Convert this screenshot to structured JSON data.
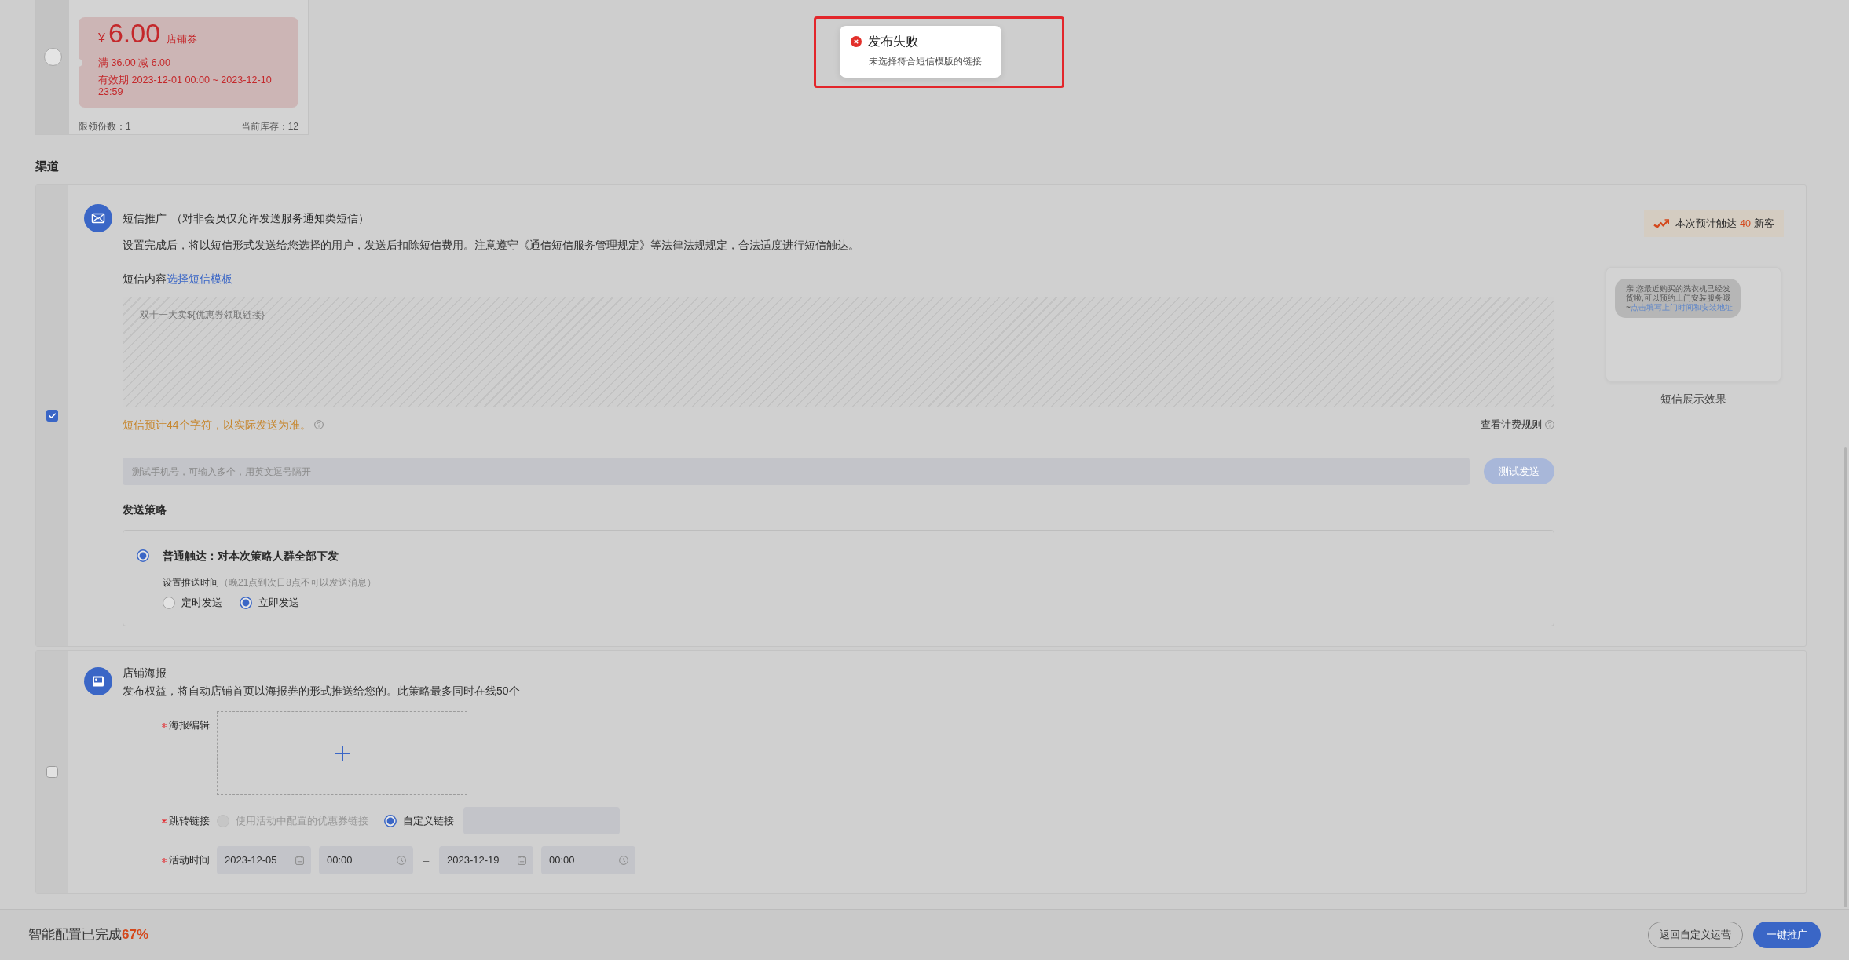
{
  "toast": {
    "kind": "error",
    "highlighted": true,
    "title": "发布失败",
    "message": "未选择符合短信模版的链接"
  },
  "coupon": {
    "selected": false,
    "currency": "¥",
    "amount": "6.00",
    "type": "店铺券",
    "rule": "满 36.00 减 6.00",
    "validity": "有效期 2023-12-01 00:00 ~ 2023-12-10 23:59",
    "limit": "限领份数：1",
    "stock": "当前库存：12"
  },
  "section_title": "渠道",
  "channels": [
    {
      "kind": "sms",
      "checked": true,
      "title": "短信推广",
      "note": "（对非会员仅允许发送服务通知类短信）",
      "description": "设置完成后，将以短信形式发送给您选择的用户，发送后扣除短信费用。注意遵守《通信短信服务管理规定》等法律法规规定，合法适度进行短信触达。",
      "content_label": "短信内容",
      "template_link": "选择短信模板",
      "content": "双十一大卖${优惠券领取链接}",
      "char_hint": "短信预计44个字符，以实际发送为准。",
      "pricing_link": "查看计费规则",
      "test_phone": {
        "placeholder": "测试手机号，可输入多个，用英文逗号隔开",
        "button": {
          "label": "测试发送",
          "disabled": true
        }
      },
      "strategy_title": "发送策略",
      "strategies": [
        {
          "label": "普通触达：对本次策略人群全部下发",
          "selected": true,
          "time_label": "设置推送时间",
          "time_note": "（晚21点到次日8点不可以发送消息）",
          "time_options": [
            {
              "label": "定时发送",
              "selected": false
            },
            {
              "label": "立即发送",
              "selected": true
            }
          ]
        }
      ],
      "reach": {
        "label": "本次预计触达",
        "count": "40",
        "unit": "新客"
      },
      "preview": {
        "message": "亲,您最近购买的洗衣机已经发货啦,可以预约上门安装服务哦~",
        "link": "点击填写上门时间和安装地址",
        "caption": "短信展示效果"
      }
    },
    {
      "kind": "poster",
      "checked": false,
      "title": "店铺海报",
      "description": "发布权益，将自动店铺首页以海报券的形式推送给您的。此策略最多同时在线50个",
      "fields": [
        {
          "kind": "upload",
          "label": "海报编辑",
          "required": true
        },
        {
          "kind": "link",
          "label": "跳转链接",
          "required": true,
          "options": [
            {
              "label": "使用活动中配置的优惠券链接",
              "selected": false,
              "disabled": true
            },
            {
              "label": "自定义链接",
              "selected": true,
              "disabled": false
            }
          ]
        },
        {
          "kind": "daterange",
          "label": "活动时间",
          "required": true,
          "start_date": "2023-12-05",
          "start_time": "00:00",
          "separator": "–",
          "end_date": "2023-12-19",
          "end_time": "00:00"
        }
      ]
    }
  ],
  "footer": {
    "progress_label": "智能配置已完成",
    "progress_value": "67%",
    "buttons": [
      {
        "label": "返回自定义运营",
        "kind": "secondary"
      },
      {
        "label": "一键推广",
        "kind": "primary"
      }
    ]
  }
}
